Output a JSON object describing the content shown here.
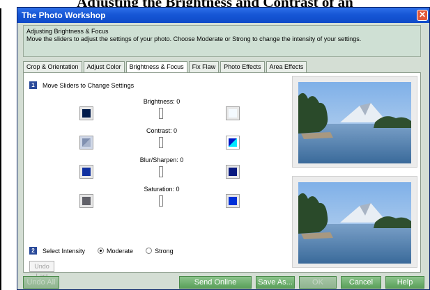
{
  "page_heading": "Adjusting the Brightness and Contrast of an",
  "window": {
    "title": "The Photo Workshop",
    "close_glyph": "✕"
  },
  "info": {
    "title": "Adjusting Brightness & Focus",
    "description": "Move the sliders to adjust the settings of your photo. Choose Moderate or Strong to change the intensity of your settings."
  },
  "tabs": [
    {
      "label": "Crop & Orientation",
      "active": false
    },
    {
      "label": "Adjust Color",
      "active": false
    },
    {
      "label": "Brightness & Focus",
      "active": true
    },
    {
      "label": "Fix Flaw",
      "active": false
    },
    {
      "label": "Photo Effects",
      "active": false
    },
    {
      "label": "Area Effects",
      "active": false
    }
  ],
  "steps": {
    "step1": {
      "number": "1",
      "label": "Move Sliders to Change Settings"
    },
    "step2": {
      "number": "2",
      "label": "Select Intensity"
    }
  },
  "sliders": {
    "brightness": {
      "label": "Brightness: 0",
      "value": 0
    },
    "contrast": {
      "label": "Contrast: 0",
      "value": 0
    },
    "blur": {
      "label": "Blur/Sharpen: 0",
      "value": 0
    },
    "saturation": {
      "label": "Saturation: 0",
      "value": 0
    }
  },
  "intensity": {
    "options": [
      "Moderate",
      "Strong"
    ],
    "selected": "Moderate"
  },
  "undo_last": "Undo Last",
  "buttons": {
    "undo_all": "Undo All",
    "send_online": "Send Online",
    "save_as": "Save As...",
    "ok": "OK",
    "cancel": "Cancel",
    "help": "Help"
  },
  "colors": {
    "titlebar": "#1657d6",
    "step_badge": "#2a4a9a",
    "button_green": "#5aa05a"
  }
}
